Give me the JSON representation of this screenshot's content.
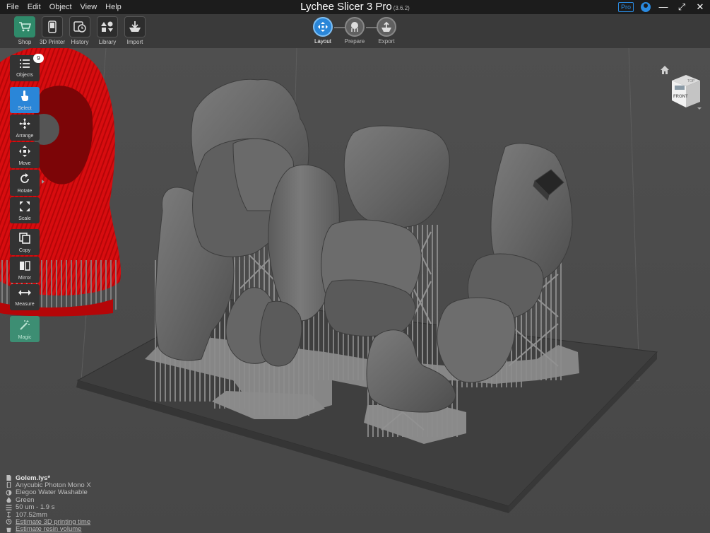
{
  "app": {
    "title": "Lychee Slicer 3 Pro",
    "version": "(3.6.2)",
    "badge": "Pro"
  },
  "menu": [
    "File",
    "Edit",
    "Object",
    "View",
    "Help"
  ],
  "toolbar": {
    "buttons": [
      {
        "label": "Shop",
        "icon": "cart-icon"
      },
      {
        "label": "3D Printer",
        "icon": "printer-icon"
      },
      {
        "label": "History",
        "icon": "history-icon"
      },
      {
        "label": "Library",
        "icon": "library-icon"
      },
      {
        "label": "Import",
        "icon": "import-icon"
      }
    ]
  },
  "workflow": {
    "steps": [
      {
        "label": "Layout",
        "icon": "layout-icon",
        "active": true
      },
      {
        "label": "Prepare",
        "icon": "support-icon",
        "active": false
      },
      {
        "label": "Export",
        "icon": "export-icon",
        "active": false
      }
    ]
  },
  "viewcube": {
    "top": "TOP",
    "front": "FRONT"
  },
  "left_tools": {
    "objects_count": "9",
    "items": [
      {
        "label": "Objects",
        "icon": "list-icon"
      },
      {
        "label": "Select",
        "icon": "pointer-icon",
        "selected": true
      },
      {
        "label": "Arrange",
        "icon": "arrange-icon"
      },
      {
        "label": "Move",
        "icon": "move-icon"
      },
      {
        "label": "Rotate",
        "icon": "rotate-icon"
      },
      {
        "label": "Scale",
        "icon": "scale-icon"
      },
      {
        "label": "Copy",
        "icon": "copy-icon"
      },
      {
        "label": "Mirror",
        "icon": "mirror-icon"
      },
      {
        "label": "Measure",
        "icon": "measure-icon"
      },
      {
        "label": "Magic",
        "icon": "magic-wand-icon"
      }
    ]
  },
  "info": {
    "file": "Golem.lys*",
    "printer": "Anycubic Photon Mono X",
    "resin": "Elegoo Water Washable",
    "color": "Green",
    "layer": "50 um - 1.9 s",
    "height": "107.52mm",
    "estimate_time": "Estimate 3D printing time",
    "estimate_resin": "Estimate resin volume"
  },
  "colors": {
    "accent": "#2a86d8",
    "model": "#6e6e6e",
    "selected_model": "#d40d10",
    "magic": "#3d8e73"
  }
}
